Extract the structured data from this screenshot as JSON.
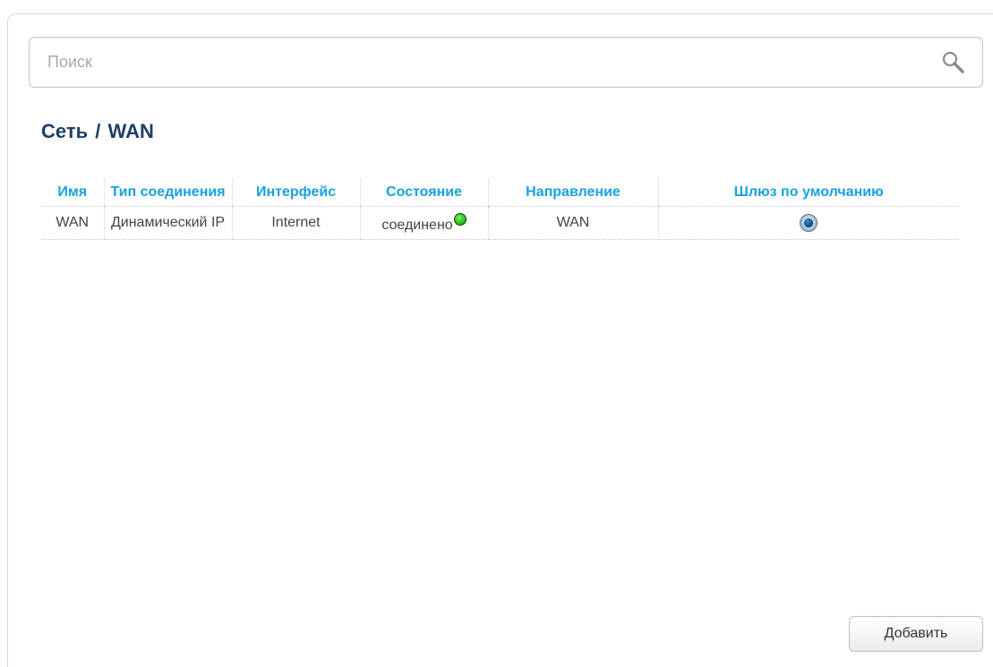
{
  "search": {
    "placeholder": "Поиск",
    "value": "",
    "icon": "search-icon"
  },
  "title": {
    "section": "Сеть",
    "separator": "/",
    "page": "WAN"
  },
  "table": {
    "headers": [
      "Имя",
      "Тип соединения",
      "Интерфейс",
      "Состояние",
      "Направление",
      "Шлюз по умолчанию"
    ],
    "rows": [
      {
        "name": "WAN",
        "type": "Динамический IP",
        "interface": "Internet",
        "status": "соединено",
        "status_indicator": "connected-green",
        "direction": "WAN",
        "default_gateway": true
      }
    ]
  },
  "actions": {
    "add_label": "Добавить"
  },
  "colors": {
    "header_text": "#17a2de",
    "title_text": "#1d3f66",
    "status_ok": "#2fc21f"
  }
}
